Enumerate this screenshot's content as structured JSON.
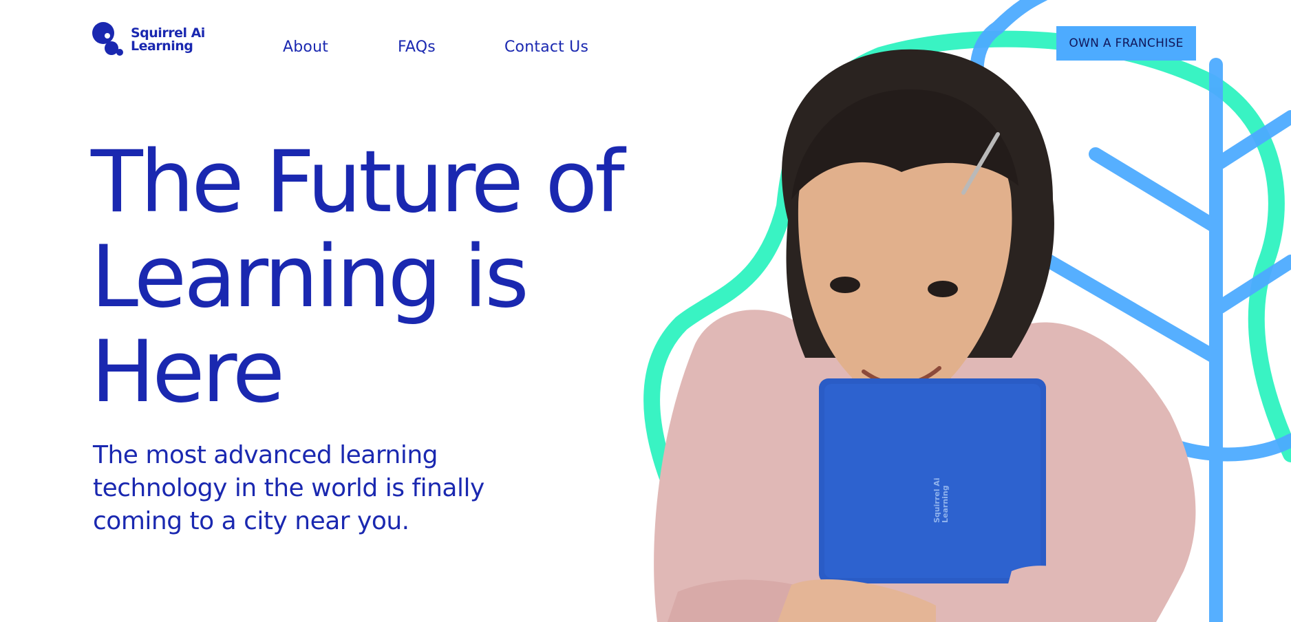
{
  "brand": {
    "name_line1": "Squirrel Ai",
    "name_line2": "Learning"
  },
  "nav": {
    "items": [
      {
        "label": "About"
      },
      {
        "label": "FAQs"
      },
      {
        "label": "Contact Us"
      }
    ]
  },
  "cta": {
    "label": "OWN A FRANCHISE"
  },
  "hero": {
    "title_line1": "The Future of",
    "title_line2": "Learning is",
    "title_line3": "Here",
    "subtitle_line1": "The most advanced learning",
    "subtitle_line2": "technology in the world is finally",
    "subtitle_line3": "coming to a city near you."
  },
  "book_brand": {
    "line1": "Squirrel Ai",
    "line2": "Learning"
  },
  "colors": {
    "brand_blue": "#1a28b0",
    "accent_sky": "#4dabff",
    "accent_mint": "#2ef2c0",
    "book_blue": "#2a5cc6",
    "sweater_pink": "#e0b8b6"
  }
}
